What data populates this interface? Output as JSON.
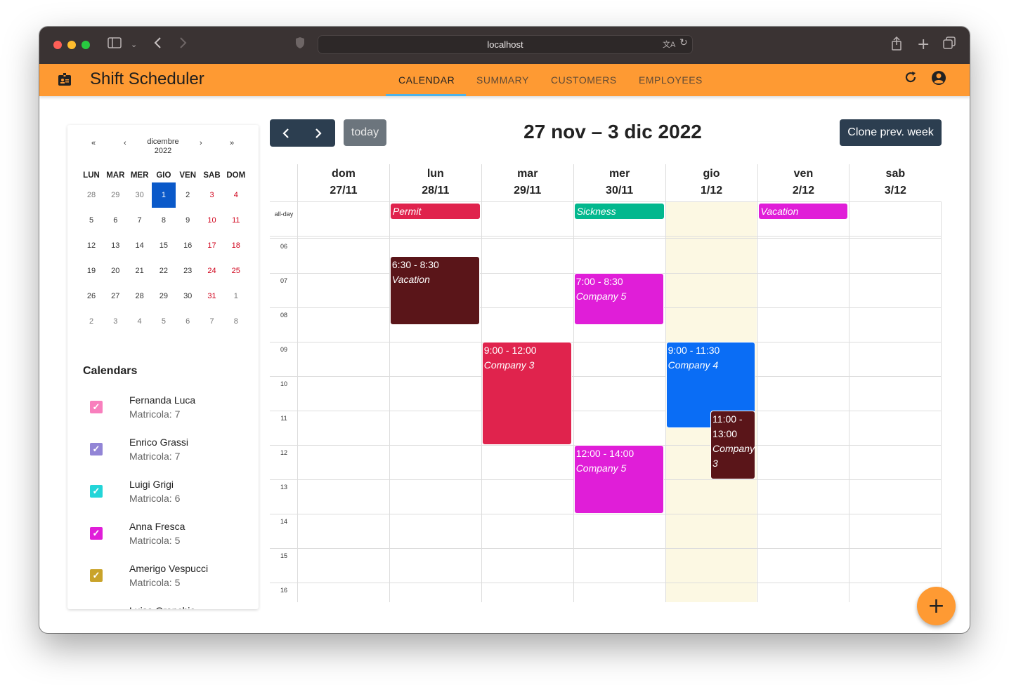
{
  "browser": {
    "url": "localhost"
  },
  "app": {
    "title": "Shift Scheduler",
    "tabs": [
      "CALENDAR",
      "SUMMARY",
      "CUSTOMERS",
      "EMPLOYEES"
    ],
    "active_tab": "CALENDAR"
  },
  "mini_calendar": {
    "prev_year": "«",
    "prev_month": "‹",
    "month": "dicembre",
    "year": "2022",
    "next_month": "›",
    "next_year": "»",
    "weekdays": [
      "LUN",
      "MAR",
      "MER",
      "GIO",
      "VEN",
      "SAB",
      "DOM"
    ],
    "weeks": [
      [
        "28",
        "29",
        "30",
        "1",
        "2",
        "3",
        "4"
      ],
      [
        "5",
        "6",
        "7",
        "8",
        "9",
        "10",
        "11"
      ],
      [
        "12",
        "13",
        "14",
        "15",
        "16",
        "17",
        "18"
      ],
      [
        "19",
        "20",
        "21",
        "22",
        "23",
        "24",
        "25"
      ],
      [
        "26",
        "27",
        "28",
        "29",
        "30",
        "31",
        "1"
      ],
      [
        "2",
        "3",
        "4",
        "5",
        "6",
        "7",
        "8"
      ]
    ],
    "selected": "1"
  },
  "calendars": {
    "heading": "Calendars",
    "items": [
      {
        "name": "Fernanda Luca",
        "sub": "Matricola: 7",
        "color": "#f87fbd",
        "checked": true
      },
      {
        "name": "Enrico Grassi",
        "sub": "Matricola: 7",
        "color": "#9285d6",
        "checked": true
      },
      {
        "name": "Luigi Grigi",
        "sub": "Matricola: 6",
        "color": "#23d5d8",
        "checked": true
      },
      {
        "name": "Anna Fresca",
        "sub": "Matricola: 5",
        "color": "#e01ed8",
        "checked": true
      },
      {
        "name": "Amerigo Vespucci",
        "sub": "Matricola: 5",
        "color": "#c9a32a",
        "checked": true
      },
      {
        "name": "Luisa Granchio",
        "sub": "",
        "color": "#f87fbd",
        "checked": true
      }
    ]
  },
  "toolbar": {
    "prev": "‹",
    "next": "›",
    "today": "today",
    "range_title": "27 nov – 3 dic 2022",
    "clone": "Clone prev. week"
  },
  "week": {
    "days": [
      {
        "name": "dom",
        "date": "27/11"
      },
      {
        "name": "lun",
        "date": "28/11"
      },
      {
        "name": "mar",
        "date": "29/11"
      },
      {
        "name": "mer",
        "date": "30/11"
      },
      {
        "name": "gio",
        "date": "1/12"
      },
      {
        "name": "ven",
        "date": "2/12"
      },
      {
        "name": "sab",
        "date": "3/12"
      }
    ],
    "today_index": 4,
    "allday_label": "all-day",
    "hours": [
      "06",
      "07",
      "08",
      "09",
      "10",
      "11",
      "12",
      "13",
      "14",
      "15",
      "16"
    ],
    "allday_events": [
      {
        "day": 1,
        "title": "Permit",
        "color": "#e0234d"
      },
      {
        "day": 3,
        "title": "Sickness",
        "color": "#03b88e"
      },
      {
        "day": 5,
        "title": "Vacation",
        "color": "#e01ed8"
      }
    ],
    "events": [
      {
        "day": 1,
        "start": 6.5,
        "end": 8.5,
        "time": "6:30 - 8:30",
        "title": "Vacation",
        "color": "#5a1519"
      },
      {
        "day": 3,
        "start": 7.0,
        "end": 8.5,
        "time": "7:00 - 8:30",
        "title": "Company 5",
        "color": "#e01ed8"
      },
      {
        "day": 2,
        "start": 9.0,
        "end": 12.0,
        "time": "9:00 - 12:00",
        "title": "Company 3",
        "color": "#e0234d"
      },
      {
        "day": 4,
        "start": 9.0,
        "end": 11.5,
        "time": "9:00 - 11:30",
        "title": "Company 4",
        "color": "#0a6df5"
      },
      {
        "day": 4,
        "start": 11.0,
        "end": 13.0,
        "time": "11:00 - 13:00",
        "title": "Company 3",
        "color": "#5a1519",
        "half": true
      },
      {
        "day": 3,
        "start": 12.0,
        "end": 14.0,
        "time": "12:00 - 14:00",
        "title": "Company 5",
        "color": "#e01ed8"
      }
    ]
  },
  "fab_label": "+"
}
